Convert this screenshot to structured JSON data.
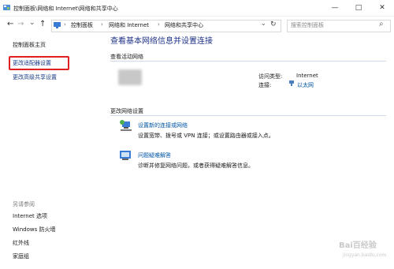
{
  "window": {
    "title": "控制面板\\网络和 Internet\\网络和共享中心",
    "min_glyph": "—",
    "max_glyph": "□",
    "close_glyph": "✕"
  },
  "nav": {
    "back_glyph": "←",
    "forward_glyph": "→",
    "up_glyph": "↑",
    "recent_glyph": "⌄",
    "refresh_glyph": "↻",
    "dropdown_glyph": "⌄",
    "crumbs": [
      "控制面板",
      "网络和 Internet",
      "网络和共享中心"
    ],
    "crumb_sep": "›"
  },
  "search": {
    "placeholder": "搜索控制面板",
    "icon_glyph": "⌕"
  },
  "sidebar": {
    "home": "控制面板主页",
    "adapter": "更改适配器设置",
    "sharing": "更改高级共享设置",
    "see_also_heading": "另请参阅",
    "see_also": [
      "Internet 选项",
      "Windows 防火墙",
      "红外线",
      "家庭组"
    ]
  },
  "main": {
    "heading": "查看基本网络信息并设置连接",
    "active_section": "查看活动网络",
    "access_type_label": "访问类型:",
    "access_type_value": "Internet",
    "connection_label": "连接:",
    "connection_value": "以太网",
    "change_section": "更改网络设置",
    "new_conn_title": "设置新的连接或网络",
    "new_conn_desc": "设置宽带、拨号或 VPN 连接；或设置路由器或接入点。",
    "troubleshoot_title": "问题疑难解答",
    "troubleshoot_desc": "诊断并修复网络问题，或者获得疑难解答信息。"
  },
  "watermark": {
    "line1": "Bai百经验",
    "line2": "jingyan.baidu.com"
  },
  "colors": {
    "link": "#0055a6",
    "nav_link": "#1a3b87",
    "highlight": "#e02020",
    "title": "#1e3287"
  }
}
